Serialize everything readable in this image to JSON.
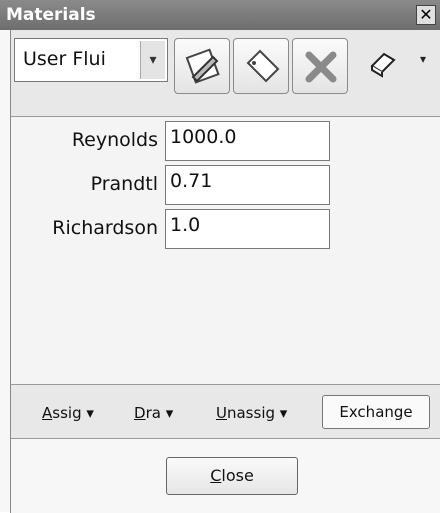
{
  "window": {
    "title": "Materials",
    "close_glyph": "✕"
  },
  "toolbar": {
    "combo_value": "User Flui",
    "combo_arrow": "▾",
    "buttons": [
      "edit-material-icon",
      "new-material-icon",
      "delete-icon",
      "eraser-icon"
    ],
    "menu_arrow": "▾"
  },
  "fields": [
    {
      "label": "Reynolds",
      "value": "1000.0"
    },
    {
      "label": "Prandtl",
      "value": "0.71"
    },
    {
      "label": "Richardson",
      "value": "1.0"
    }
  ],
  "actions": {
    "assign": {
      "accel": "A",
      "rest": "ssig",
      "arrow": "▾"
    },
    "drag": {
      "accel": "D",
      "rest": "ra",
      "arrow": "▾"
    },
    "unassign": {
      "accel": "U",
      "rest": "nassig",
      "arrow": "▾"
    },
    "exchange": "Exchange"
  },
  "footer": {
    "close_accel": "C",
    "close_rest": "lose"
  },
  "colors": {
    "titlebar": "#7a7a7a",
    "delete_x": "#8a8a8a"
  }
}
